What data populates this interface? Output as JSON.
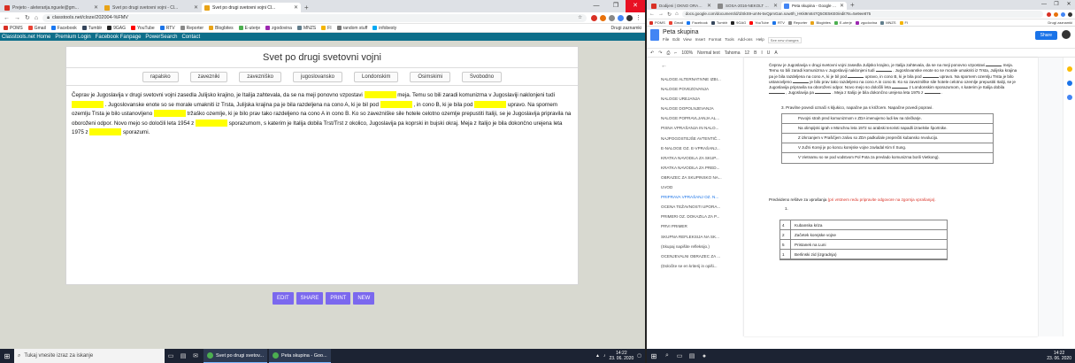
{
  "left": {
    "tabs": [
      {
        "title": "Prejeto - aleterarija.nguele@gm...",
        "fav": "#d93025",
        "active": false
      },
      {
        "title": "Svet po drugi svetovni vojni - Cl...",
        "fav": "#e8a317",
        "active": false
      },
      {
        "title": "Svet po drugi svetovni vojni Cl...",
        "fav": "#e8a317",
        "active": true
      }
    ],
    "new_tab": "+",
    "url": "classtools.net/cloze/202004-%FMV",
    "bookmarks": [
      "POMS",
      "Gmail",
      "Facebook",
      "Tumblr",
      "9GAG",
      "YouTube",
      "RTV",
      "Reporter",
      "Blogbites",
      "E-uterje",
      "zgodovina",
      "MNZS",
      "FI",
      "random stuff",
      "infobesty"
    ],
    "bookmarks_right": "Drugi zaznamki",
    "site_nav": [
      "Classtools.net Home",
      "Premium Login",
      "Facebook Fanpage",
      "PowerSearch",
      "Contact"
    ],
    "activity": {
      "title": "Svet po drugi svetovni vojni",
      "words": [
        "rapalsko",
        "zavezniki",
        "zavezniško",
        "jugoslovansko",
        "Londonskim",
        "Osimskimi",
        "Svobodno"
      ],
      "segments": [
        "Čeprav je Jugoslavija v drugi svetovni vojni zasedla Julijsko krajino, je Italija zahtevala, da se na meji ponovno vzpostavi",
        "meja. Temu so bili zaradi komunizma v Jugoslaviji naklonjeni tudi",
        ". Jugoslovanske enote so se morale umakniti iz Trsta, Julijska krajina pa je bila razdeljena na cono A, ki je bil pod",
        ", in cono B, ki je bila pod",
        "upravo. Na spornem ozemlju Trsta je bilo ustanovljeno",
        "tržaško ozemlje, ki je bilo prav tako razdeljeno na cono A in cono B. Ko so zavezniške sile hotele celotno ozemlje prepustiti Italiji, se je Jugoslavija pripravila na oboroženi odpor. Novo mejo so določili leta 1954 z",
        "sporazumom, s katerim je Italija dobila Trst/Trst z okolico, Jugoslavija pa koprski in bujski okraj. Meja z Italijo je bila dokončno urejena leta 1975 z",
        "sporazumi."
      ],
      "buttons": [
        "EDIT",
        "SHARE",
        "PRINT",
        "NEW"
      ]
    }
  },
  "right": {
    "tabs": [
      {
        "title": "Dodijeni | OKNO ORAZHOVS",
        "fav": "#d93025",
        "active": false
      },
      {
        "title": "SOSA-2016-NEKOLT SANG...",
        "fav": "#888888",
        "active": false
      },
      {
        "title": "Peta skupina - Google Docs",
        "fav": "#4285f4",
        "active": true
      }
    ],
    "url": "docs.google.com/document/d/1lSkS9-umN-5vQpmGan.sow0h_HKk9m847Q5OE5KE0/edit?ts=5e9ee875",
    "bookmarks": [
      "POMS",
      "Gmail",
      "Facebook",
      "Tumblr",
      "9GAG",
      "YouTube",
      "RTV",
      "Reporter",
      "Blogbites",
      "E-uterje",
      "zgodovina",
      "MNZS",
      "FI"
    ],
    "bookmarks_right": "Drugi zaznamki",
    "doc": {
      "title": "Peta skupina",
      "menu": [
        "File",
        "Edit",
        "View",
        "Insert",
        "Format",
        "Tools",
        "Add-ons",
        "Help"
      ],
      "save_status": "See new changes",
      "share": "Share",
      "toolbar": [
        "100%",
        "Normal text",
        "Tahoma",
        "12",
        "B",
        "I",
        "U",
        "A"
      ],
      "outline": [
        "NALOGE ALTERNATIVNE IZBI...",
        "NALOGE POVEZOVANJA",
        "NALOGE UREJANJA",
        "NALOGE DOPOLNJEVANJA",
        "NALOGE POPRAVLJANJA AL...",
        "PISNA VPRAŠANJA IN NALO...",
        "NAJPOGOSTEJŠE AVTENTIČ...",
        "E-NALOGE OZ. E-VPRAŠANJ...",
        "KRATKA NAVODILA ZA SKUP...",
        "KRATKA NAVODILA ZA PRED...",
        "OBRAZEC ZA SKUPINSKO NA...",
        "UVOD",
        "PRIPRAVA VPRAŠANJ OZ. N...",
        "OCENA TEŽAVNOSTI UPORA...",
        "PRIMERI OZ. DOKAZILA ZA P...",
        "PRVI PRIMER",
        "SKUPNA REFLEKSIJA NA SK...",
        "(Skupaj napišite refleksijo.)",
        "OCENJEVALNI OBRAZEC ZA ...",
        "(Določite se en kriterij in opiši..."
      ],
      "active_outline": 12,
      "para_parts": [
        "Čeprav je Jugoslavija v drugi svetovni vojni zasedla Julijsko krajino, je Italija zahtevala, da se na meji ponovno vzpostavi",
        "meja. Temu so bili zaradi komunizma v Jugoslaviji naklonjeni tudi",
        ". Jugoslovanske enote so se morale umakniti iz Trsta, Julijska krajina pa je bila razdeljena na cono A, ki je bil pod",
        "upravo, in cono B, ki je bila pod",
        "upravo. Na spornem ozemlju Trsta je bilo ustanovljeno",
        "je bilo prav tako razdeljeno na cono A in cono B. Ko so zavezniške sile hotele celotno ozemlje prepustiti Italiji, se je Jugoslavija pripravila na oboroženi odpor. Novo mejo so določili leta",
        "z Londonskim sporazumom, s katerim je Italija dobila",
        ", Jugoslavija pa",
        ". Meja z Italijo je bila dokončno urejena leta 1975 z",
        "."
      ],
      "q3": "3.   Pravilne povedi označi s kljukico, napačne pa s križcem. Napačne povedi popravi.",
      "statements": [
        "Povojni strah pred komunizmom v ZDA imenujemo ludi kw na rdečkarje.",
        "Na olimpijski igrah v Münchnu leta 1972 so arabski teroristi napadli izraelske športnike.",
        "Z izkrcanjem v Prašičjem zalivu so ZDA padkušale preprečiti kubansko revolucijo.",
        "V Južni Koreji je po koncu korejske vojne zavladal Kim Il Sung.",
        "V Vietnamu so se pod vodstvom Pol Pota za prevlado komunizma borili Vietkong)."
      ],
      "predv_a": "Predvideno rešitve za vprašanja",
      "predv_b": "(pri vrstnem redu pripravite odgovore na zgornja vprašanja).",
      "num1": "1.",
      "events": [
        {
          "n": "4",
          "t": "Kubanska kriza"
        },
        {
          "n": "2",
          "t": "Začetek korejske vojne"
        },
        {
          "n": "5",
          "t": "Pristanek na Luni"
        },
        {
          "n": "1",
          "t": "Berlinski zid (izgradnja)"
        }
      ]
    }
  },
  "taskbar_left": {
    "search": "Tukaj vnesite izraz za iskanje",
    "apps": [
      "Svet po drugi svetov...",
      "Peta skupina - Goo..."
    ],
    "time": "14:22",
    "date": "23. 06. 2020"
  },
  "taskbar_right": {
    "time": "14:22",
    "date": "23. 06. 2020"
  }
}
